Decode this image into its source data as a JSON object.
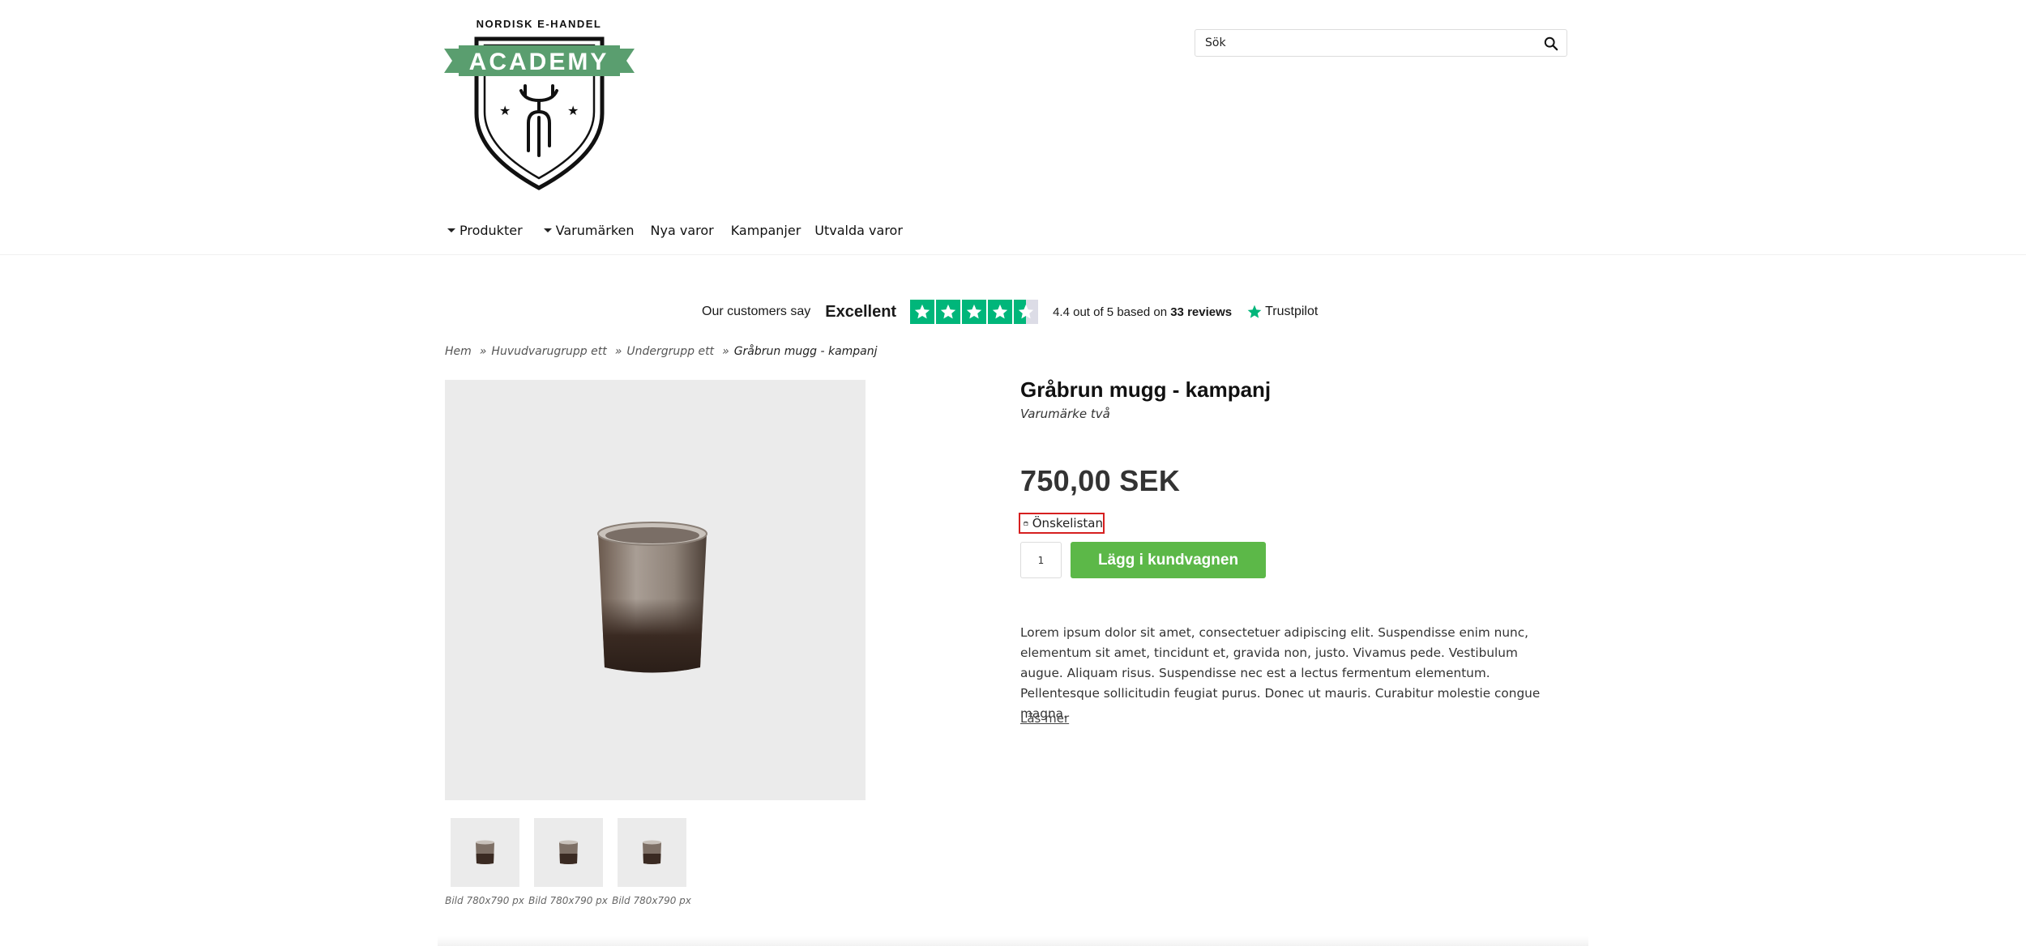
{
  "header": {
    "logo": {
      "top_text": "NORDISK E-HANDEL",
      "banner_text": "ACADEMY",
      "color": "#5a9e6f"
    },
    "search": {
      "placeholder": "Sök",
      "icon": "search-icon"
    }
  },
  "nav": {
    "items": [
      {
        "label": "Produkter",
        "dropdown": true
      },
      {
        "label": "Varumärken",
        "dropdown": true
      },
      {
        "label": "Nya varor",
        "dropdown": false
      },
      {
        "label": "Kampanjer",
        "dropdown": false
      },
      {
        "label": "Utvalda varor",
        "dropdown": false
      }
    ]
  },
  "trustpilot": {
    "customers_say": "Our customers say",
    "rating_word": "Excellent",
    "stars": 4.5,
    "score_prefix": "4.4 out of 5 based on",
    "review_count": "33 reviews",
    "brand": "Trustpilot",
    "color": "#00b67a"
  },
  "breadcrumb": {
    "items": [
      "Hem",
      "Huvudvarugrupp ett",
      "Undergrupp ett"
    ],
    "separator": "»",
    "current": "Gråbrun mugg - kampanj"
  },
  "product": {
    "title": "Gråbrun mugg - kampanj",
    "brand": "Varumärke två",
    "price": "750,00 SEK",
    "wishlist_label": "Önskelistan",
    "quantity": "1",
    "add_to_cart_label": "Lägg i kundvagnen",
    "add_to_cart_color": "#5cb848",
    "description": "Lorem ipsum dolor sit amet, consectetuer adipiscing elit. Suspendisse enim nunc, elementum sit amet, tincidunt et, gravida non, justo. Vivamus pede. Vestibulum augue. Aliquam risus. Suspendisse nec est a lectus fermentum elementum. Pellentesque sollicitudin feugiat purus. Donec ut mauris. Curabitur molestie congue magna.",
    "read_more_label": "Läs mer",
    "thumbnails": [
      {
        "caption": "Bild 780x790 px"
      },
      {
        "caption": "Bild 780x790 px"
      },
      {
        "caption": "Bild 780x790 px"
      }
    ]
  }
}
